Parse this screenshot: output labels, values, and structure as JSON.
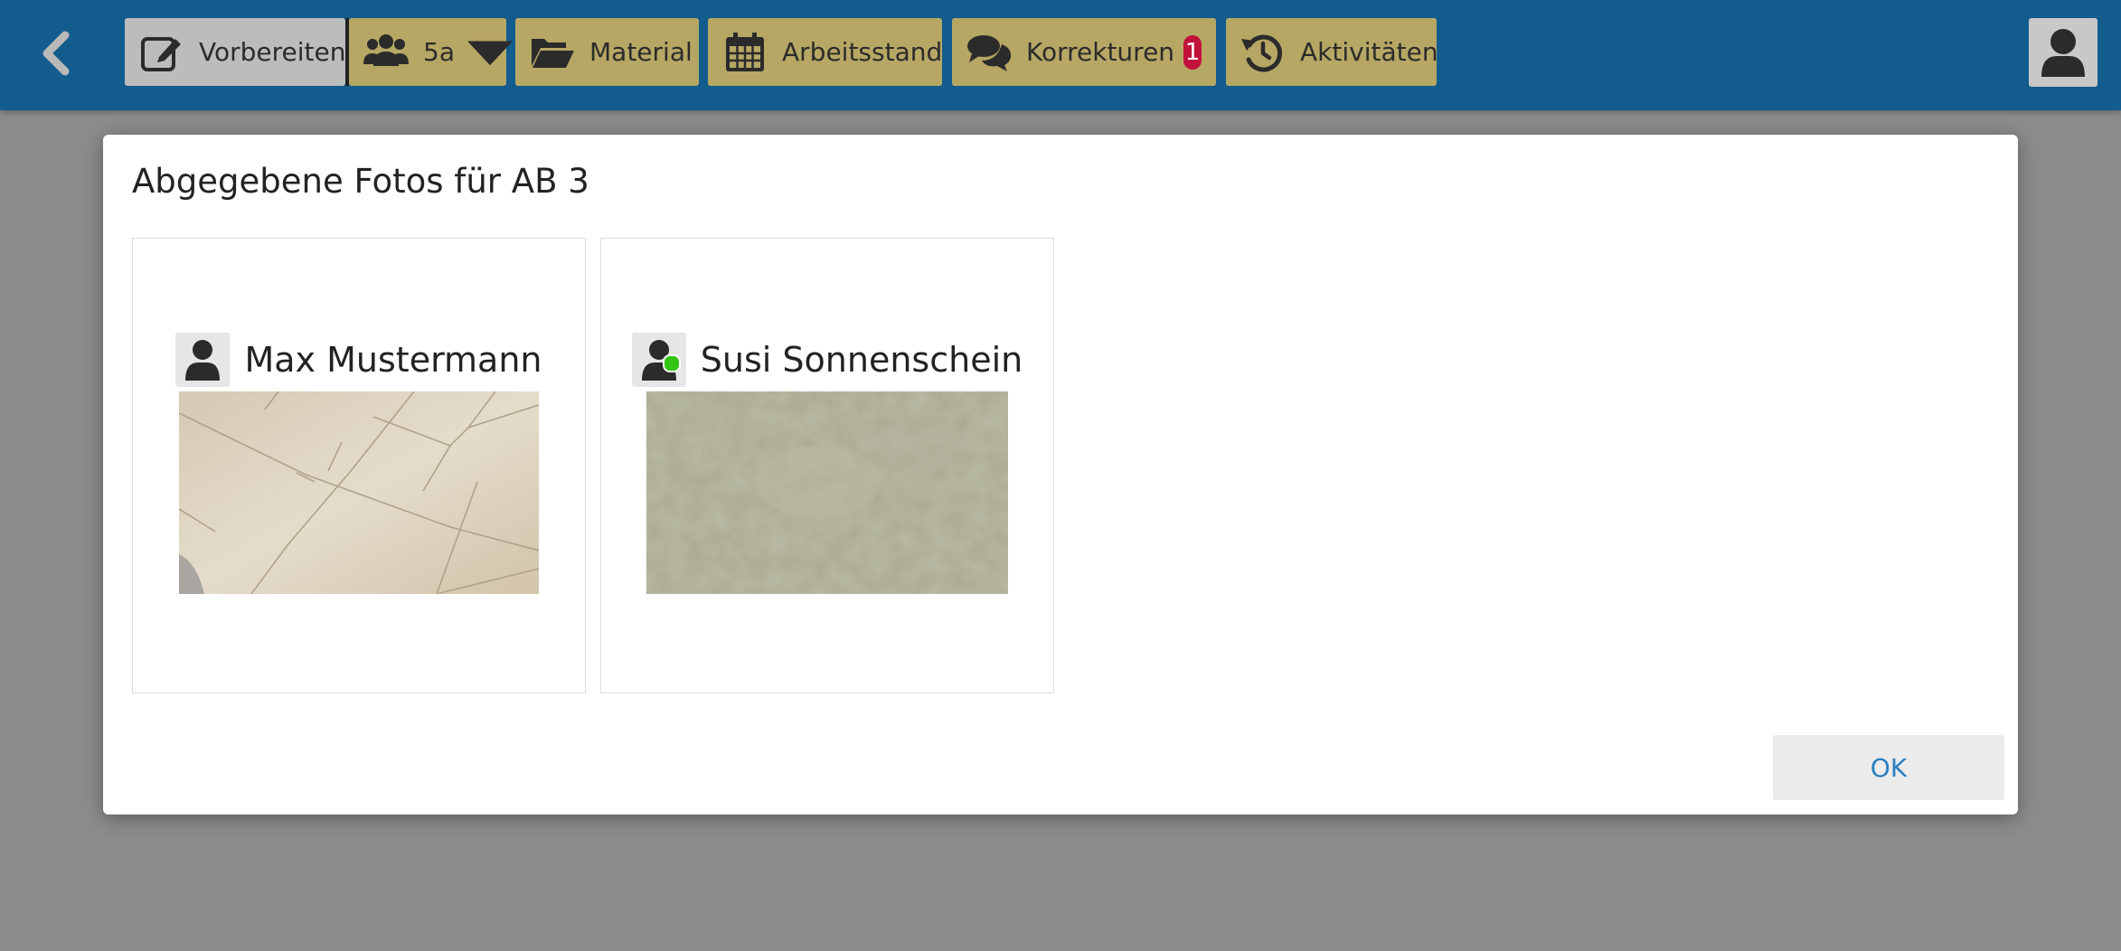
{
  "toolbar": {
    "back_icon": "chevron-left-icon",
    "buttons": [
      {
        "label": "Vorbereiten",
        "icon": "edit-icon",
        "active": true
      },
      {
        "label": "5a",
        "icon": "users-icon"
      },
      {
        "label": "Material",
        "icon": "folder-open-icon"
      },
      {
        "label": "Arbeitsstand",
        "icon": "calendar-icon"
      },
      {
        "label": "Korrekturen",
        "icon": "comments-icon",
        "badge": "1"
      },
      {
        "label": "Aktivitäten",
        "icon": "history-icon"
      }
    ],
    "user_icon": "user-icon"
  },
  "dialog": {
    "title": "Abgegebene Fotos für AB 3",
    "submissions": [
      {
        "student": "Max Mustermann",
        "online": false,
        "photo": "tiled floor photo"
      },
      {
        "student": "Susi Sonnenschein",
        "online": true,
        "photo": "carpet photo"
      }
    ],
    "ok_label": "OK"
  },
  "colors": {
    "topbar": "#125c8e",
    "nav_button": "#b7a764",
    "nav_button_active": "#bcbcbc",
    "badge": "#c2123b",
    "online": "#33c414",
    "ok_text": "#2a7fc0",
    "backdrop": "#8c8c8c"
  }
}
